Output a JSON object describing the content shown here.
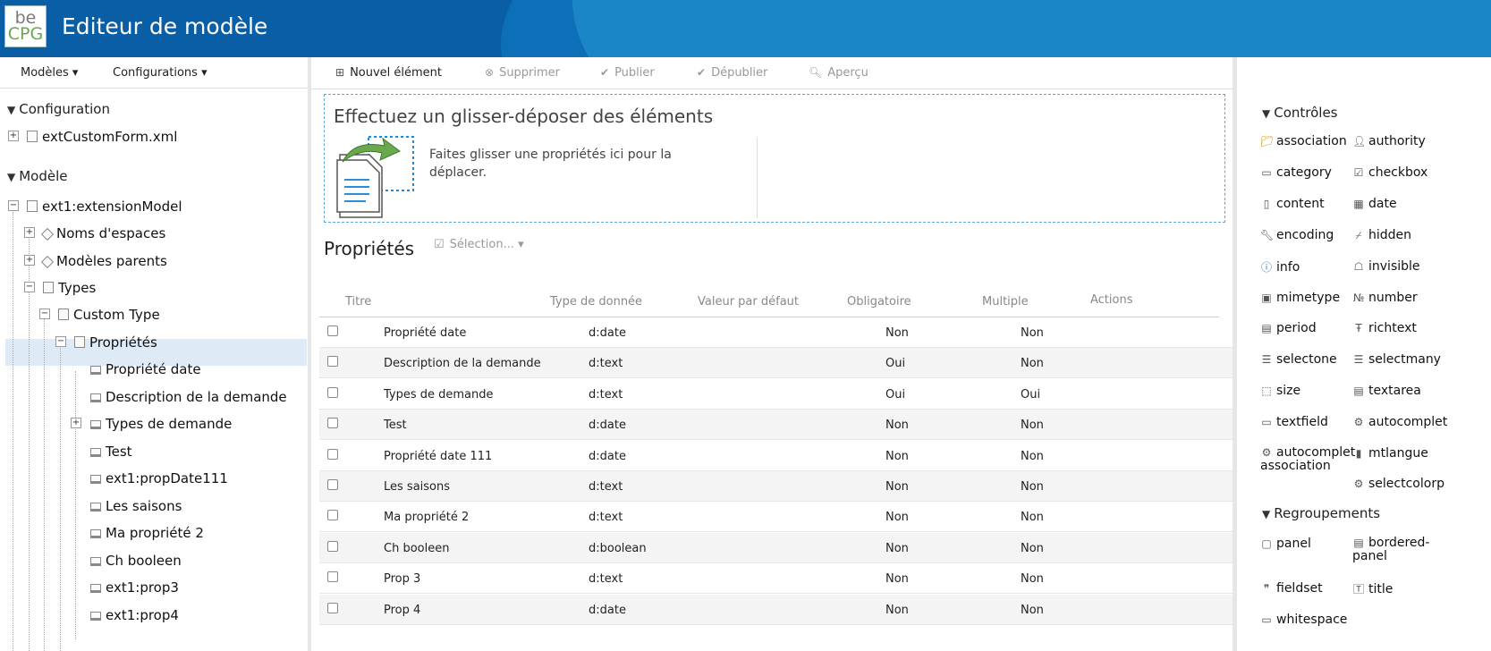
{
  "header": {
    "logo_top": "be",
    "logo_bottom": "CPG",
    "title": "Editeur de modèle"
  },
  "left_menu": {
    "models": "Modèles ▾",
    "configurations": "Configurations ▾"
  },
  "tree": {
    "configuration": {
      "title": "Configuration",
      "file": "extCustomForm.xml"
    },
    "model": {
      "title": "Modèle",
      "root": "ext1:extensionModel",
      "namespaces": "Noms d'espaces",
      "parents": "Modèles parents",
      "types": "Types",
      "custom_type": "Custom Type",
      "properties": "Propriétés",
      "items": [
        "Propriété date",
        "Description de la demande",
        "Types de demande",
        "Test",
        "ext1:propDate111",
        "Les saisons",
        "Ma propriété 2",
        "Ch booleen",
        "ext1:prop3",
        "ext1:prop4"
      ]
    }
  },
  "toolbar": {
    "new": "Nouvel élément",
    "delete": "Supprimer",
    "publish": "Publier",
    "unpublish": "Dépublier",
    "preview": "Aperçu"
  },
  "dropzone": {
    "title": "Effectuez un glisser-déposer des éléments",
    "text": "Faites glisser une propriétés ici pour la déplacer."
  },
  "properties": {
    "title": "Propriétés",
    "selection": "Sélection... ▾",
    "columns": [
      "Titre",
      "Type de donnée",
      "Valeur par défaut",
      "Obligatoire",
      "Multiple",
      "Actions"
    ],
    "rows": [
      [
        "Propriété date",
        "d:date",
        "",
        "Non",
        "Non"
      ],
      [
        "Description de la demande",
        "d:text",
        "",
        "Oui",
        "Non"
      ],
      [
        "Types de demande",
        "d:text",
        "",
        "Oui",
        "Oui"
      ],
      [
        "Test",
        "d:date",
        "",
        "Non",
        "Non"
      ],
      [
        "Propriété date 111",
        "d:date",
        "",
        "Non",
        "Non"
      ],
      [
        "Les saisons",
        "d:text",
        "",
        "Non",
        "Non"
      ],
      [
        "Ma propriété 2",
        "d:text",
        "",
        "Non",
        "Non"
      ],
      [
        "Ch booleen",
        "d:boolean",
        "",
        "Non",
        "Non"
      ],
      [
        "Prop 3",
        "d:text",
        "",
        "Non",
        "Non"
      ],
      [
        "Prop 4",
        "d:date",
        "",
        "Non",
        "Non"
      ]
    ]
  },
  "controls": {
    "title": "Contrôles",
    "items": [
      "association",
      "authority",
      "category",
      "checkbox",
      "content",
      "date",
      "encoding",
      "hidden",
      "info",
      "invisible",
      "mimetype",
      "number",
      "period",
      "richtext",
      "selectone",
      "selectmany",
      "size",
      "textarea",
      "textfield",
      "autocomplet",
      "autocomplet association",
      "mtlangue",
      "selectcolorp"
    ]
  },
  "groups": {
    "title": "Regroupements",
    "items": [
      "panel",
      "bordered-panel",
      "fieldset",
      "title",
      "whitespace"
    ]
  }
}
